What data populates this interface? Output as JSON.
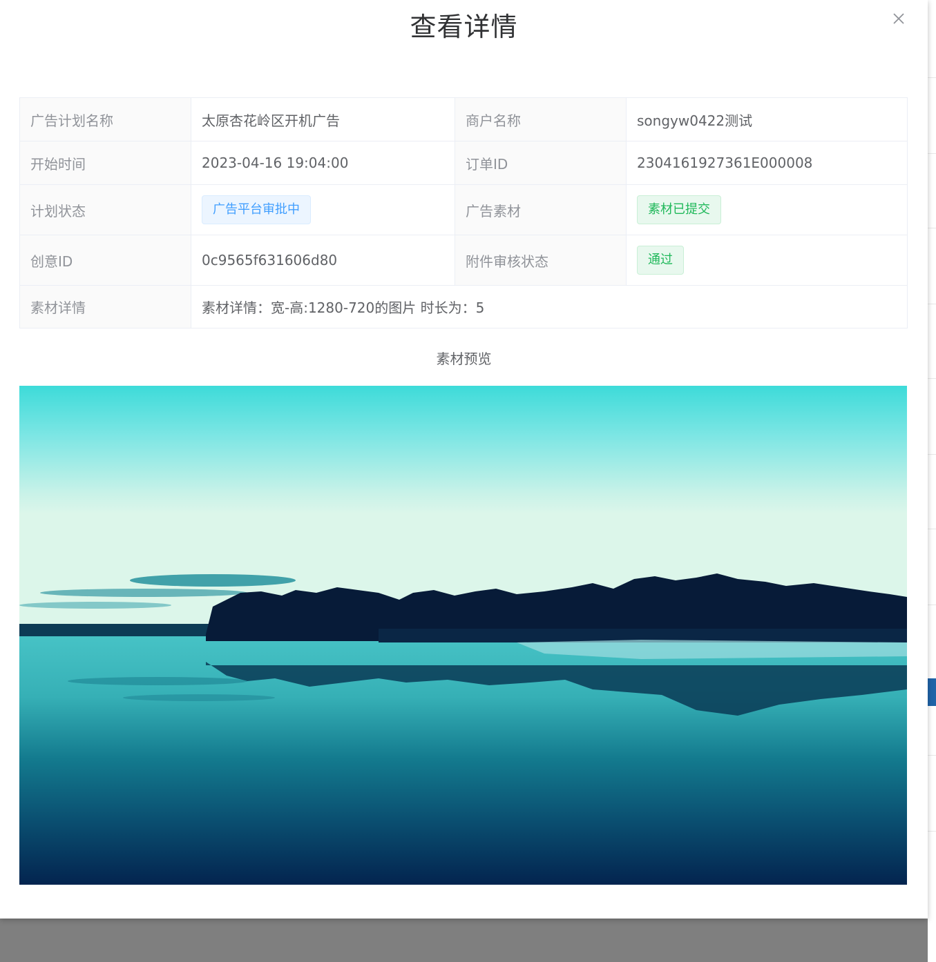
{
  "dialog": {
    "title": "查看详情",
    "close_icon": "close-icon"
  },
  "details": {
    "plan_name_label": "广告计划名称",
    "plan_name_value": "太原杏花岭区开机广告",
    "merchant_label": "商户名称",
    "merchant_value": "songyw0422测试",
    "start_time_label": "开始时间",
    "start_time_value": "2023-04-16 19:04:00",
    "order_id_label": "订单ID",
    "order_id_value": "2304161927361E000008",
    "plan_status_label": "计划状态",
    "plan_status_value": "广告平台审批中",
    "ad_material_label": "广告素材",
    "ad_material_value": "素材已提交",
    "creative_id_label": "创意ID",
    "creative_id_value": "0c9565f631606d80",
    "attachment_status_label": "附件审核状态",
    "attachment_status_value": "通过",
    "material_detail_label": "素材详情",
    "material_detail_value": "素材详情：宽-高:1280-720的图片 时长为：5"
  },
  "preview": {
    "title": "素材预览",
    "image": "lake-sunset-landscape"
  },
  "colors": {
    "tag_blue": "#409eff",
    "tag_green": "#67c23a",
    "label_bg": "#fafafa"
  }
}
